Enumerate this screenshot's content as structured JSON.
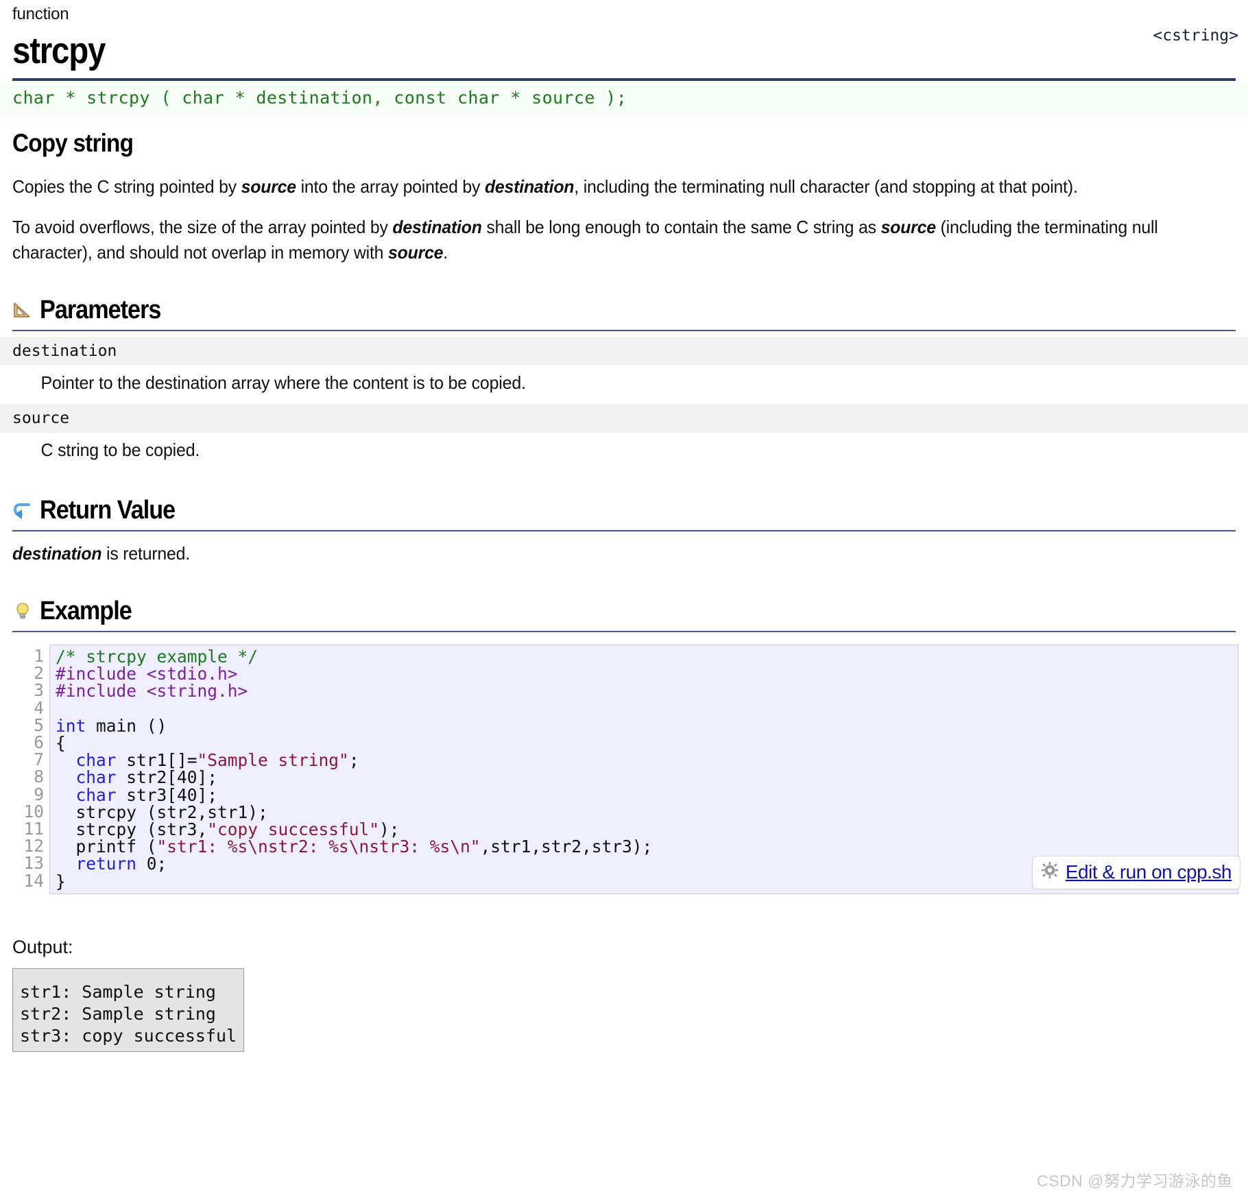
{
  "header": {
    "kind": "function",
    "title": "strcpy",
    "include": "<cstring>"
  },
  "prototype": "char * strcpy ( char * destination, const char * source );",
  "summary": {
    "heading": "Copy string",
    "paragraph1": {
      "part1": "Copies the C string pointed by ",
      "em1": "source",
      "part2": " into the array pointed by ",
      "em2": "destination",
      "part3": ", including the terminating null character (and stopping at that point)."
    },
    "paragraph2": {
      "part1": "To avoid overflows, the size of the array pointed by ",
      "em1": "destination",
      "part2": " shall be long enough to contain the same C string as ",
      "em2": "source",
      "part3": " (including the terminating null character), and should not overlap in memory with ",
      "em3": "source",
      "part4": "."
    }
  },
  "parameters": {
    "heading": "Parameters",
    "icon": "triangular-ruler-icon",
    "items": [
      {
        "name": "destination",
        "description": "Pointer to the destination array where the content is to be copied."
      },
      {
        "name": "source",
        "description": "C string to be copied."
      }
    ]
  },
  "return_value": {
    "heading": "Return Value",
    "icon": "return-arrow-icon",
    "text": {
      "em1": "destination",
      "rest": " is returned."
    }
  },
  "example": {
    "heading": "Example",
    "icon": "lightbulb-icon",
    "line_numbers": [
      "1",
      "2",
      "3",
      "4",
      "5",
      "6",
      "7",
      "8",
      "9",
      "10",
      "11",
      "12",
      "13",
      "14"
    ],
    "lines": [
      [
        {
          "t": "/* strcpy example */",
          "c": "comment"
        }
      ],
      [
        {
          "t": "#include <stdio.h>",
          "c": "pre"
        }
      ],
      [
        {
          "t": "#include <string.h>",
          "c": "pre"
        }
      ],
      [
        {
          "t": "",
          "c": "plain"
        }
      ],
      [
        {
          "t": "int",
          "c": "kw"
        },
        {
          "t": " main ()",
          "c": "plain"
        }
      ],
      [
        {
          "t": "{",
          "c": "plain"
        }
      ],
      [
        {
          "t": "  ",
          "c": "plain"
        },
        {
          "t": "char",
          "c": "kw"
        },
        {
          "t": " str1[]=",
          "c": "plain"
        },
        {
          "t": "\"Sample string\"",
          "c": "str"
        },
        {
          "t": ";",
          "c": "plain"
        }
      ],
      [
        {
          "t": "  ",
          "c": "plain"
        },
        {
          "t": "char",
          "c": "kw"
        },
        {
          "t": " str2[40];",
          "c": "plain"
        }
      ],
      [
        {
          "t": "  ",
          "c": "plain"
        },
        {
          "t": "char",
          "c": "kw"
        },
        {
          "t": " str3[40];",
          "c": "plain"
        }
      ],
      [
        {
          "t": "  strcpy (str2,str1);",
          "c": "plain"
        }
      ],
      [
        {
          "t": "  strcpy (str3,",
          "c": "plain"
        },
        {
          "t": "\"copy successful\"",
          "c": "str"
        },
        {
          "t": ");",
          "c": "plain"
        }
      ],
      [
        {
          "t": "  printf (",
          "c": "plain"
        },
        {
          "t": "\"str1: %s\\nstr2: %s\\nstr3: %s\\n\"",
          "c": "str"
        },
        {
          "t": ",str1,str2,str3);",
          "c": "plain"
        }
      ],
      [
        {
          "t": "  ",
          "c": "plain"
        },
        {
          "t": "return",
          "c": "kw"
        },
        {
          "t": " 0;",
          "c": "plain"
        }
      ],
      [
        {
          "t": "}",
          "c": "plain"
        }
      ]
    ],
    "edit_run": {
      "label": "Edit & run on cpp.sh",
      "icon": "gear-icon"
    }
  },
  "output": {
    "label": "Output:",
    "text": "str1: Sample string\nstr2: Sample string\nstr3: copy successful"
  },
  "watermark": "CSDN @努力学习游泳的鱼",
  "colors": {
    "rule_navy": "#2c3d66",
    "rule_thin": "#40568c",
    "prototype_bg": "#f7fdf7",
    "prototype_text": "#1f7a1f",
    "code_bg": "#eeeeff",
    "param_bg": "#f2f2f2",
    "link_blue": "#1313a8",
    "output_bg": "#e4e4e4",
    "comment": "#1f7a1f",
    "preprocessor": "#7d1f9e",
    "keyword": "#2222cc",
    "string": "#8b1a3a"
  }
}
